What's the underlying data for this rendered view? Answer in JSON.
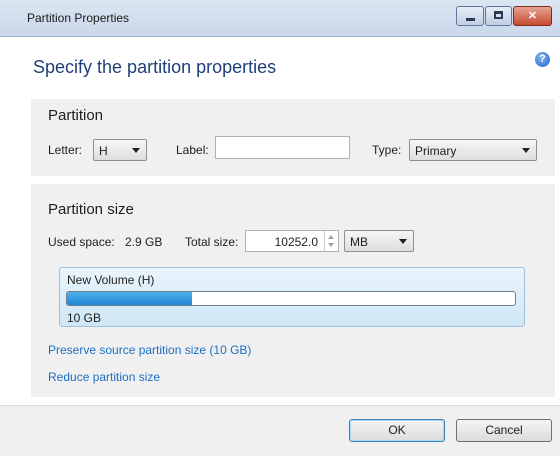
{
  "window": {
    "title": "Partition Properties"
  },
  "header": {
    "heading": "Specify the partition properties",
    "help_icon": "help-icon"
  },
  "partition": {
    "section_title": "Partition",
    "letter_label": "Letter:",
    "letter_value": "H",
    "label_label": "Label:",
    "label_value": "",
    "type_label": "Type:",
    "type_value": "Primary"
  },
  "size": {
    "section_title": "Partition size",
    "used_label": "Used space:",
    "used_value": "2.9 GB",
    "total_label": "Total size:",
    "total_value": "10252.0",
    "unit_value": "MB",
    "volume_name": "New Volume (H)",
    "volume_size": "10 GB",
    "used_fraction": 0.28
  },
  "links": {
    "preserve": "Preserve source partition size (10 GB)",
    "reduce": "Reduce partition size"
  },
  "footer": {
    "ok_label": "OK",
    "cancel_label": "Cancel"
  }
}
